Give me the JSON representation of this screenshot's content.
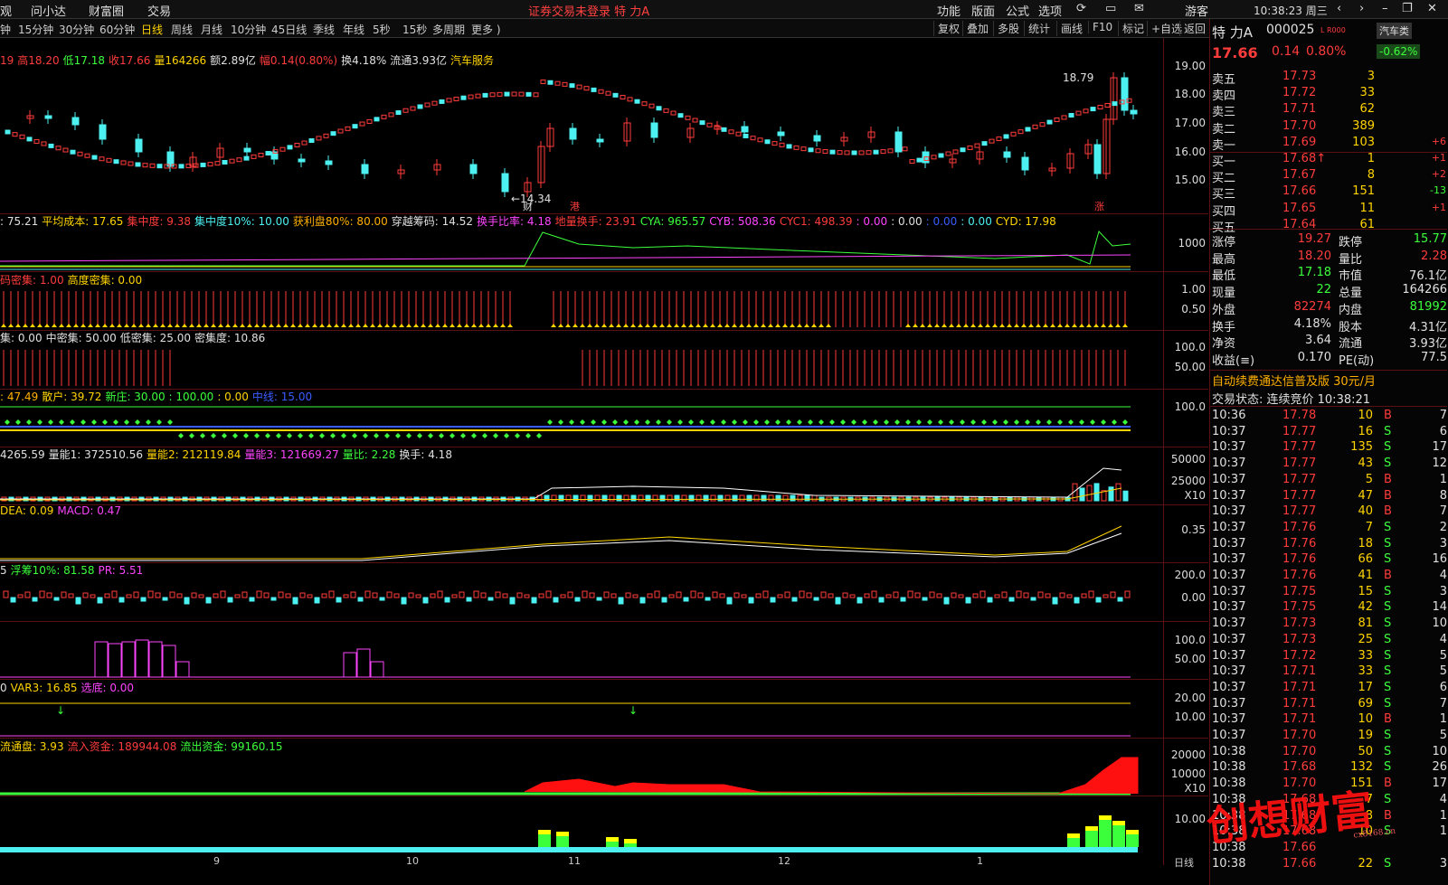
{
  "menu": {
    "items": [
      "观",
      "问小达",
      "财富圈",
      "交易"
    ],
    "center": "证券交易未登录  特 力A",
    "right": [
      "功能",
      "版面",
      "公式",
      "选项"
    ],
    "user": "游客",
    "time": "10:38:23 周三"
  },
  "periods": [
    "钟",
    "15分钟",
    "30分钟",
    "60分钟",
    "日线",
    "周线",
    "月线",
    "10分钟",
    "45日线",
    "季线",
    "年线",
    "5秒",
    "15秒",
    "多周期",
    "更多 )"
  ],
  "active_period": "日线",
  "tools": [
    "复权",
    "叠加",
    "多股",
    "统计",
    "画线",
    "F10",
    "标记",
    "+自选",
    "返回"
  ],
  "main_info": [
    {
      "t": "19",
      "c": "red"
    },
    {
      "t": "高18.20",
      "c": "red"
    },
    {
      "t": "低17.18",
      "c": "green"
    },
    {
      "t": "收17.66",
      "c": "red"
    },
    {
      "t": "量164266",
      "c": "yellow"
    },
    {
      "t": "额2.89亿",
      "c": "white"
    },
    {
      "t": "幅0.14(0.80%)",
      "c": "red"
    },
    {
      "t": "换4.18%",
      "c": "white"
    },
    {
      "t": "流通3.93亿",
      "c": "white"
    },
    {
      "t": "汽车服务",
      "c": "yellow"
    }
  ],
  "price_annotations": {
    "high": "18.79",
    "low": "14.34",
    "marks": [
      "财",
      "港",
      "涨"
    ]
  },
  "price_axis": [
    "19.00",
    "18.00",
    "17.00",
    "16.00",
    "15.00"
  ],
  "panels": [
    {
      "id": "chip",
      "items": [
        {
          "t": ": 75.21",
          "c": "white"
        },
        {
          "t": "平均成本: 17.65",
          "c": "yellow"
        },
        {
          "t": "集中度: 9.38",
          "c": "red"
        },
        {
          "t": "集中度10%: 10.00",
          "c": "cyan"
        },
        {
          "t": "获利盘80%: 80.00",
          "c": "orange"
        },
        {
          "t": "穿越筹码: 14.52",
          "c": "white"
        },
        {
          "t": "换手比率: 4.18",
          "c": "magenta"
        },
        {
          "t": "地量换手: 23.91",
          "c": "red"
        },
        {
          "t": "CYA: 965.57",
          "c": "green"
        },
        {
          "t": "CYB: 508.36",
          "c": "magenta"
        },
        {
          "t": "CYC1: 498.39",
          "c": "red"
        },
        {
          "t": ": 0.00",
          "c": "magenta"
        },
        {
          "t": ": 0.00",
          "c": "white"
        },
        {
          "t": ": 0.00",
          "c": "blue"
        },
        {
          "t": ": 0.00",
          "c": "cyan"
        },
        {
          "t": "CYD: 17.98",
          "c": "yellow"
        }
      ],
      "axis": [
        "1000"
      ]
    },
    {
      "id": "dense",
      "items": [
        {
          "t": "码密集: 1.00",
          "c": "red"
        },
        {
          "t": "高度密集: 0.00",
          "c": "yellow"
        }
      ],
      "axis": [
        "1.00",
        "0.50"
      ]
    },
    {
      "id": "conc",
      "items": [
        {
          "t": "集: 0.00",
          "c": "white"
        },
        {
          "t": "中密集: 50.00",
          "c": "white"
        },
        {
          "t": "低密集: 25.00",
          "c": "white"
        },
        {
          "t": "密集度: 10.86",
          "c": "white"
        }
      ],
      "axis": [
        "100.0",
        "50.00"
      ]
    },
    {
      "id": "retail",
      "items": [
        {
          "t": ": 47.49",
          "c": "orange"
        },
        {
          "t": "散户: 39.72",
          "c": "yellow"
        },
        {
          "t": "新庄: 30.00 : 100.00",
          "c": "green"
        },
        {
          "t": ": 0.00",
          "c": "yellow"
        },
        {
          "t": "中线: 15.00",
          "c": "blue"
        }
      ],
      "axis": [
        "100.0"
      ]
    },
    {
      "id": "vol",
      "items": [
        {
          "t": "4265.59",
          "c": "white"
        },
        {
          "t": "量能1: 372510.56",
          "c": "white"
        },
        {
          "t": "量能2: 212119.84",
          "c": "yellow"
        },
        {
          "t": "量能3: 121669.27",
          "c": "magenta"
        },
        {
          "t": "量比: 2.28",
          "c": "green"
        },
        {
          "t": "换手: 4.18",
          "c": "white"
        }
      ],
      "axis": [
        "50000",
        "25000",
        "X10"
      ]
    },
    {
      "id": "macd",
      "items": [
        {
          "t": "DEA: 0.09",
          "c": "yellow"
        },
        {
          "t": "MACD: 0.47",
          "c": "magenta"
        }
      ],
      "axis": [
        "0.35"
      ]
    },
    {
      "id": "float",
      "items": [
        {
          "t": "5",
          "c": "white"
        },
        {
          "t": "浮筹10%: 81.58",
          "c": "green"
        },
        {
          "t": "PR: 5.51",
          "c": "magenta"
        }
      ],
      "axis": [
        "200.0",
        "0.00"
      ]
    },
    {
      "id": "box",
      "items": [],
      "axis": [
        "100.0",
        "50.00"
      ]
    },
    {
      "id": "var3",
      "items": [
        {
          "t": "0",
          "c": "white"
        },
        {
          "t": "VAR3: 16.85",
          "c": "yellow"
        },
        {
          "t": "选底: 0.00",
          "c": "magenta"
        }
      ],
      "axis": [
        "20.00",
        "10.00"
      ]
    },
    {
      "id": "fund",
      "items": [
        {
          "t": "流通盘: 3.93",
          "c": "yellow"
        },
        {
          "t": "流入资金: 189944.08",
          "c": "red"
        },
        {
          "t": "流出资金: 99160.15",
          "c": "green"
        }
      ],
      "axis": [
        "20000",
        "10000",
        "X10"
      ]
    },
    {
      "id": "stack",
      "items": [],
      "axis": [
        "10.00"
      ]
    }
  ],
  "dates": [
    "9",
    "10",
    "11",
    "12",
    "1"
  ],
  "date_right": "日线",
  "stock": {
    "name": "特 力A",
    "code": "000025",
    "flag": "L R000",
    "sector": "汽车类",
    "price": "17.66",
    "change": "0.14",
    "pct": "0.80%",
    "sector_pct": "-0.62%"
  },
  "asks": [
    {
      "l": "卖五",
      "p": "17.73",
      "v": "3",
      "d": ""
    },
    {
      "l": "卖四",
      "p": "17.72",
      "v": "33",
      "d": ""
    },
    {
      "l": "卖三",
      "p": "17.71",
      "v": "62",
      "d": ""
    },
    {
      "l": "卖二",
      "p": "17.70",
      "v": "389",
      "d": ""
    },
    {
      "l": "卖一",
      "p": "17.69",
      "v": "103",
      "d": "+6"
    }
  ],
  "bids": [
    {
      "l": "买一",
      "p": "17.68↑",
      "v": "1",
      "d": "+1"
    },
    {
      "l": "买二",
      "p": "17.67",
      "v": "8",
      "d": "+2"
    },
    {
      "l": "买三",
      "p": "17.66",
      "v": "151",
      "d": "-13"
    },
    {
      "l": "买四",
      "p": "17.65",
      "v": "11",
      "d": "+1"
    },
    {
      "l": "买五",
      "p": "17.64",
      "v": "61",
      "d": ""
    }
  ],
  "quote": [
    {
      "a": "涨停",
      "av": "19.27",
      "ac": "red",
      "b": "跌停",
      "bv": "15.77",
      "bc": "green"
    },
    {
      "a": "最高",
      "av": "18.20",
      "ac": "red",
      "b": "量比",
      "bv": "2.28",
      "bc": "red"
    },
    {
      "a": "最低",
      "av": "17.18",
      "ac": "green",
      "b": "市值",
      "bv": "76.1亿",
      "bc": "white"
    },
    {
      "a": "现量",
      "av": "22",
      "ac": "green",
      "b": "总量",
      "bv": "164266",
      "bc": "white"
    },
    {
      "a": "外盘",
      "av": "82274",
      "ac": "red",
      "b": "内盘",
      "bv": "81992",
      "bc": "green"
    },
    {
      "a": "换手",
      "av": "4.18%",
      "ac": "white",
      "b": "股本",
      "bv": "4.31亿",
      "bc": "white"
    },
    {
      "a": "净资",
      "av": "3.64",
      "ac": "white",
      "b": "流通",
      "bv": "3.93亿",
      "bc": "white"
    },
    {
      "a": "收益(≡)",
      "av": "0.170",
      "ac": "white",
      "b": "PE(动)",
      "bv": "77.5",
      "bc": "white"
    }
  ],
  "promo": "自动续费通达信普及版  30元/月",
  "trade_status": "交易状态: 连续竞价 10:38:21",
  "ticks": [
    [
      "10:36",
      "17.78",
      "10",
      "B",
      "7"
    ],
    [
      "10:37",
      "17.77",
      "16",
      "S",
      "6"
    ],
    [
      "10:37",
      "17.77",
      "135",
      "S",
      "17"
    ],
    [
      "10:37",
      "17.77",
      "43",
      "S",
      "12"
    ],
    [
      "10:37",
      "17.77",
      "5",
      "B",
      "1"
    ],
    [
      "10:37",
      "17.77",
      "47",
      "B",
      "8"
    ],
    [
      "10:37",
      "17.77",
      "40",
      "B",
      "7"
    ],
    [
      "10:37",
      "17.76",
      "7",
      "S",
      "2"
    ],
    [
      "10:37",
      "17.76",
      "18",
      "S",
      "3"
    ],
    [
      "10:37",
      "17.76",
      "66",
      "S",
      "16"
    ],
    [
      "10:37",
      "17.76",
      "41",
      "B",
      "4"
    ],
    [
      "10:37",
      "17.75",
      "15",
      "S",
      "3"
    ],
    [
      "10:37",
      "17.75",
      "42",
      "S",
      "14"
    ],
    [
      "10:37",
      "17.73",
      "81",
      "S",
      "10"
    ],
    [
      "10:37",
      "17.73",
      "25",
      "S",
      "4"
    ],
    [
      "10:37",
      "17.72",
      "33",
      "S",
      "5"
    ],
    [
      "10:37",
      "17.71",
      "33",
      "S",
      "5"
    ],
    [
      "10:37",
      "17.71",
      "17",
      "S",
      "6"
    ],
    [
      "10:37",
      "17.71",
      "69",
      "S",
      "7"
    ],
    [
      "10:37",
      "17.71",
      "10",
      "B",
      "1"
    ],
    [
      "10:37",
      "17.70",
      "19",
      "S",
      "5"
    ],
    [
      "10:38",
      "17.70",
      "50",
      "S",
      "10"
    ],
    [
      "10:38",
      "17.68",
      "132",
      "S",
      "26"
    ],
    [
      "10:38",
      "17.70",
      "151",
      "B",
      "17"
    ],
    [
      "10:38",
      "17.68",
      "7",
      "S",
      "4"
    ],
    [
      "10:38",
      "17.68",
      "8",
      "B",
      "1"
    ],
    [
      "10:38",
      "17.68",
      "10",
      "S",
      "1"
    ],
    [
      "10:38",
      "17.66",
      "",
      "",
      ""
    ],
    [
      "10:38",
      "17.66",
      "22",
      "S",
      "3"
    ]
  ],
  "watermark": "创想财富",
  "watermark_url": "cx8168.cn"
}
